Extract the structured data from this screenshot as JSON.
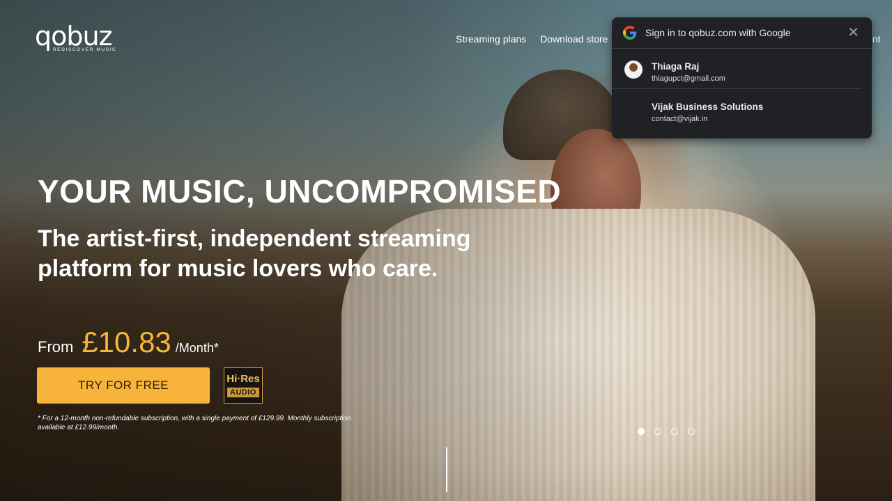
{
  "brand": {
    "logo_word": "qobuz",
    "logo_tagline": "REDISCOVER MUSIC"
  },
  "nav": {
    "items": [
      "Streaming plans",
      "Download store"
    ],
    "cutoff_fragment": "nt"
  },
  "hero": {
    "headline": "YOUR MUSIC, UNCOMPROMISED",
    "subline": "The artist-first, independent streaming platform for music lovers who care.",
    "price_from": "From",
    "price_amount": "£10.83",
    "price_unit": "/Month*",
    "cta_label": "TRY FOR FREE",
    "hires_top": "Hi·Res",
    "hires_bottom": "AUDIO",
    "footnote": "* For a 12-month non-refundable subscription, with a single payment of £129.99. Monthly subscription available at £12.99/month.",
    "carousel": {
      "count": 4,
      "active_index": 0
    }
  },
  "google_signin": {
    "title": "Sign in to qobuz.com with Google",
    "close_icon": "close-icon",
    "accounts": [
      {
        "name": "Thiaga Raj",
        "email": "thiagupct@gmail.com",
        "has_avatar": true
      },
      {
        "name": "Vijak Business Solutions",
        "email": "contact@vijak.in",
        "has_avatar": false
      }
    ]
  },
  "colors": {
    "accent": "#f8b43a",
    "price": "#f5b53a",
    "popup_bg": "#202124"
  }
}
